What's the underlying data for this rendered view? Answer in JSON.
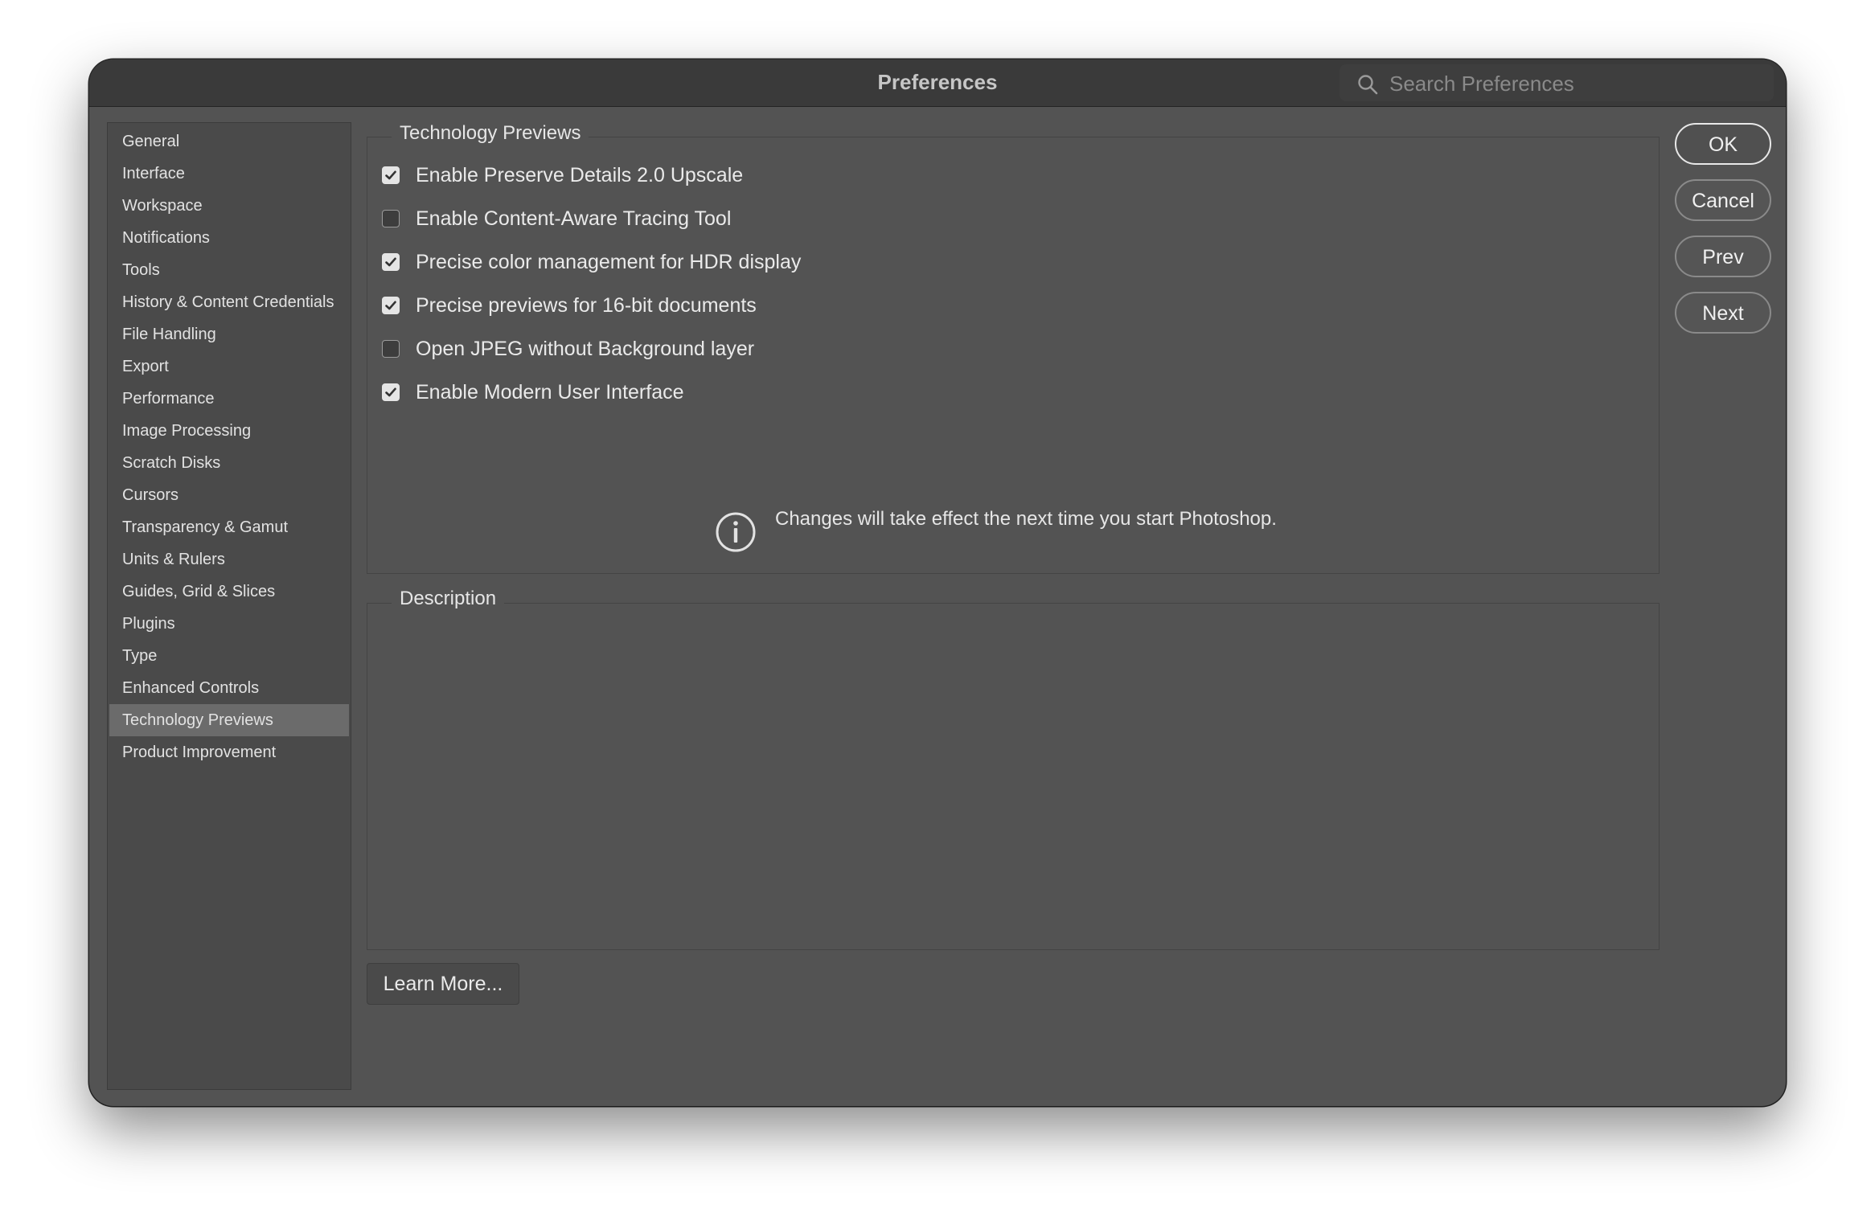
{
  "window": {
    "title": "Preferences"
  },
  "search": {
    "placeholder": "Search Preferences",
    "value": ""
  },
  "sidebar": {
    "items": [
      {
        "label": "General",
        "selected": false
      },
      {
        "label": "Interface",
        "selected": false
      },
      {
        "label": "Workspace",
        "selected": false
      },
      {
        "label": "Notifications",
        "selected": false
      },
      {
        "label": "Tools",
        "selected": false
      },
      {
        "label": "History & Content Credentials",
        "selected": false
      },
      {
        "label": "File Handling",
        "selected": false
      },
      {
        "label": "Export",
        "selected": false
      },
      {
        "label": "Performance",
        "selected": false
      },
      {
        "label": "Image Processing",
        "selected": false
      },
      {
        "label": "Scratch Disks",
        "selected": false
      },
      {
        "label": "Cursors",
        "selected": false
      },
      {
        "label": "Transparency & Gamut",
        "selected": false
      },
      {
        "label": "Units & Rulers",
        "selected": false
      },
      {
        "label": "Guides, Grid & Slices",
        "selected": false
      },
      {
        "label": "Plugins",
        "selected": false
      },
      {
        "label": "Type",
        "selected": false
      },
      {
        "label": "Enhanced Controls",
        "selected": false
      },
      {
        "label": "Technology Previews",
        "selected": true
      },
      {
        "label": "Product Improvement",
        "selected": false
      }
    ]
  },
  "tech_previews": {
    "group_label": "Technology Previews",
    "options": [
      {
        "label": "Enable Preserve Details 2.0 Upscale",
        "checked": true
      },
      {
        "label": "Enable Content-Aware Tracing Tool",
        "checked": false
      },
      {
        "label": "Precise color management for HDR display",
        "checked": true
      },
      {
        "label": "Precise previews for 16-bit documents",
        "checked": true
      },
      {
        "label": "Open JPEG without Background layer",
        "checked": false
      },
      {
        "label": "Enable Modern User Interface",
        "checked": true
      }
    ],
    "info_text": "Changes will take effect the next time you start Photoshop."
  },
  "description": {
    "group_label": "Description",
    "text": ""
  },
  "buttons": {
    "ok": "OK",
    "cancel": "Cancel",
    "prev": "Prev",
    "next": "Next",
    "learn_more": "Learn More..."
  },
  "icons": {
    "search": "search-icon",
    "info": "info-icon",
    "checkmark": "checkmark-icon"
  },
  "colors": {
    "window_bg": "#535353",
    "titlebar_bg": "#3a3a3a",
    "sidebar_bg": "#4a4a4a",
    "selected_bg": "#6b6b6b",
    "text": "#eaeaea"
  }
}
